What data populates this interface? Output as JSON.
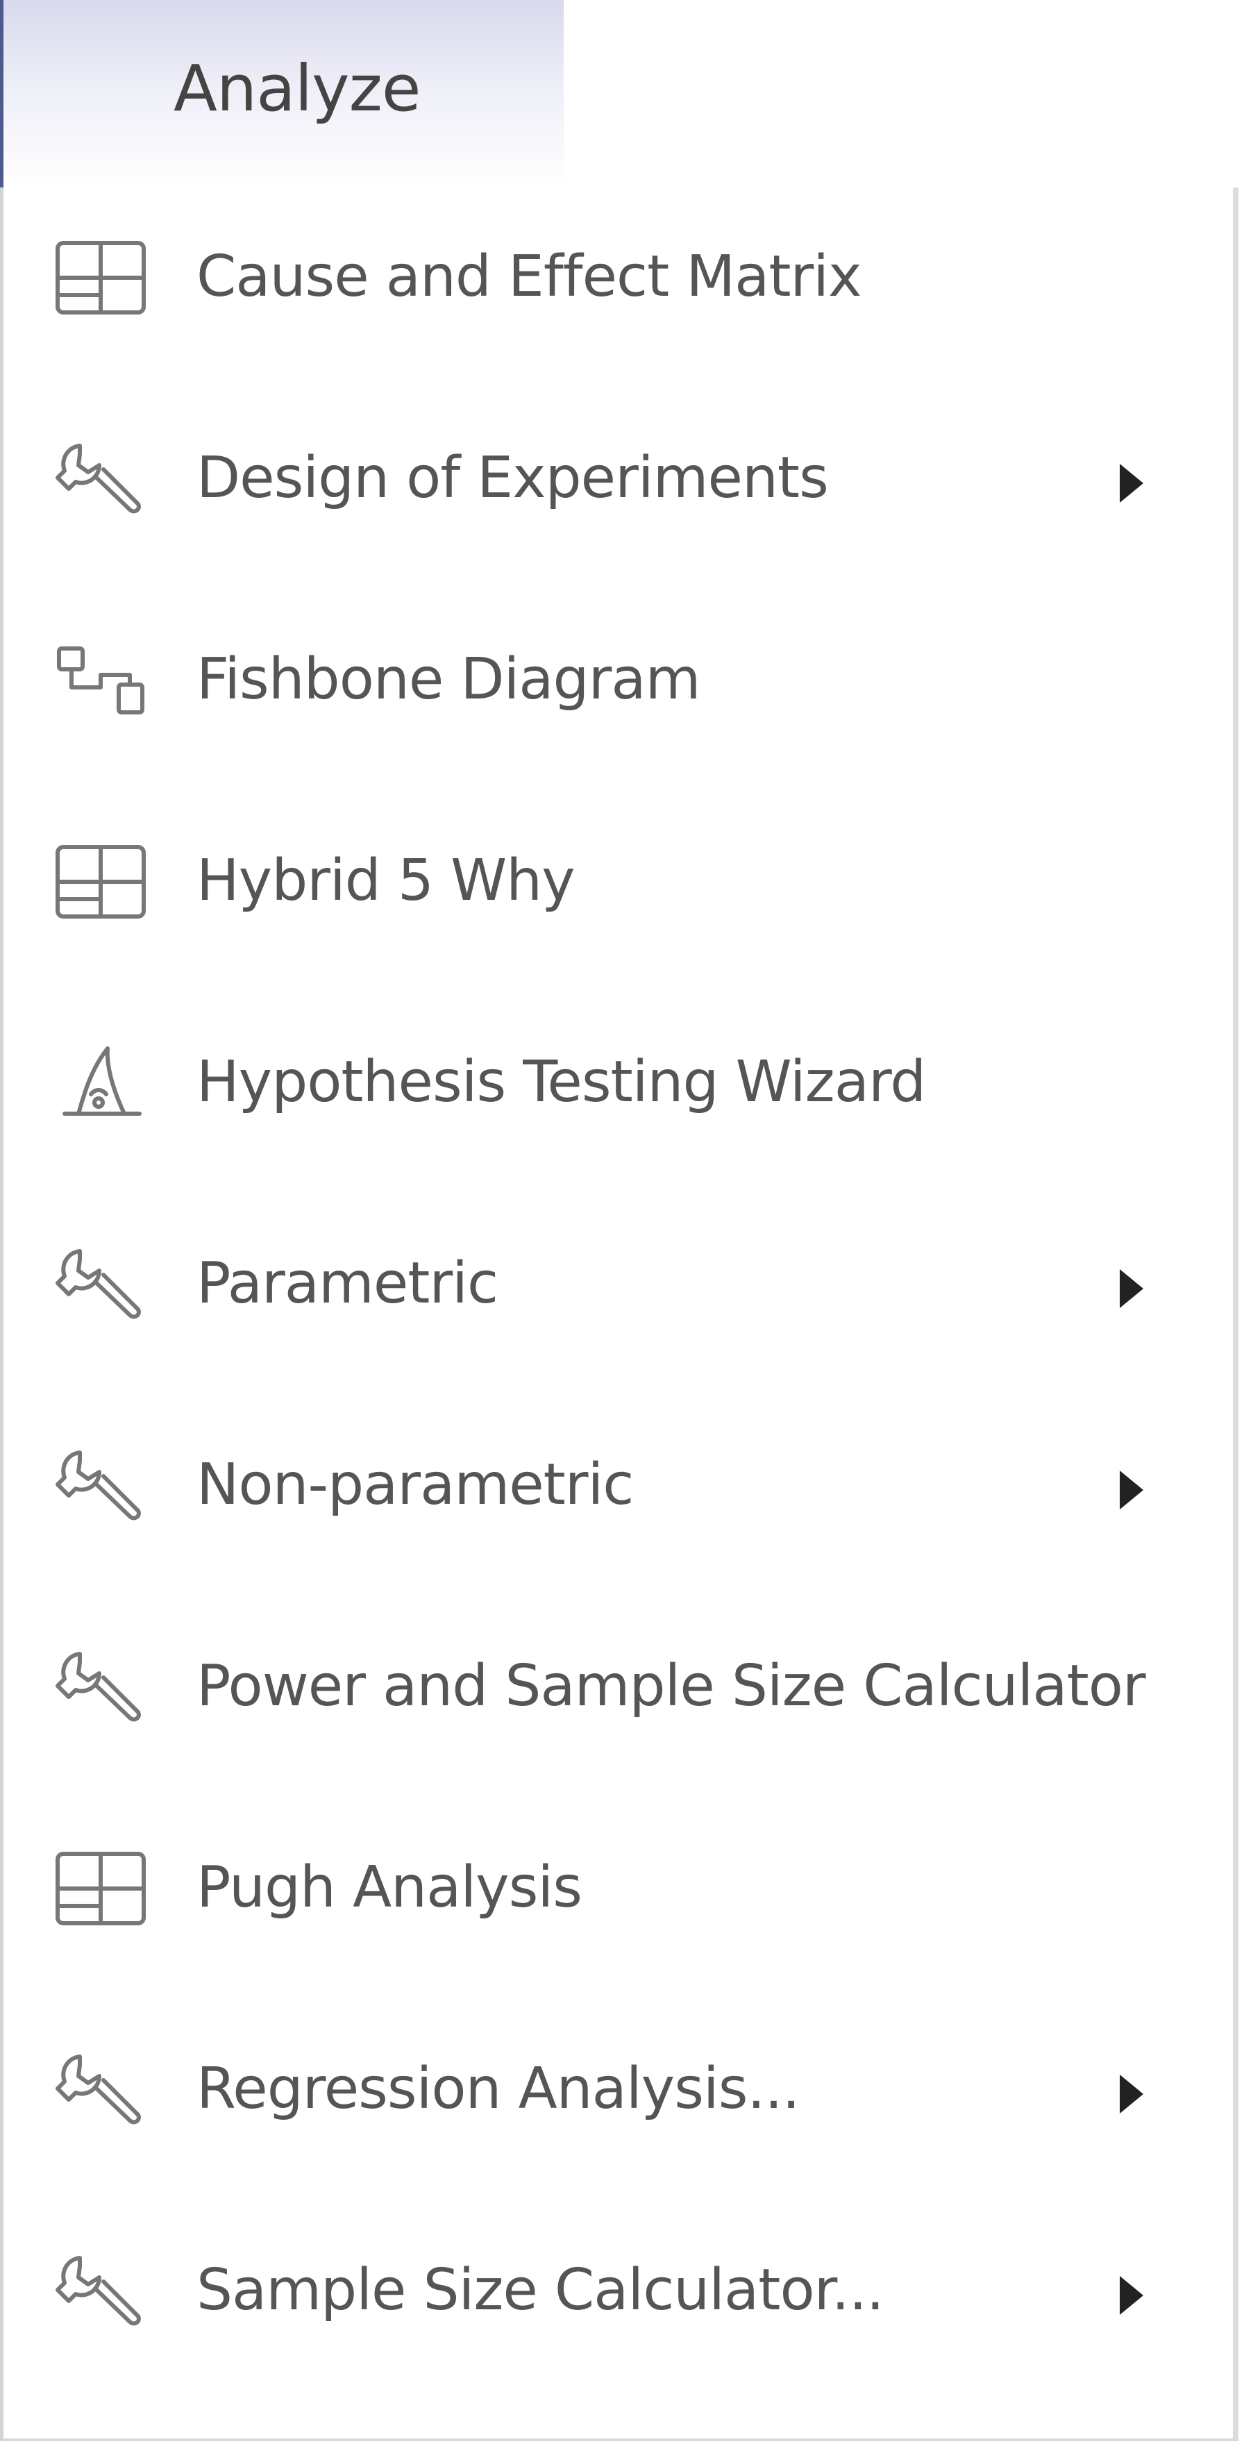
{
  "tab": {
    "label": "Analyze"
  },
  "menu": {
    "items": [
      {
        "label": "Cause and Effect Matrix",
        "icon": "table-icon",
        "has_submenu": false
      },
      {
        "label": "Design of Experiments",
        "icon": "wrench-icon",
        "has_submenu": true
      },
      {
        "label": "Fishbone Diagram",
        "icon": "diagram-icon",
        "has_submenu": false
      },
      {
        "label": "Hybrid 5 Why",
        "icon": "table-icon",
        "has_submenu": false
      },
      {
        "label": "Hypothesis Testing Wizard",
        "icon": "wizard-hat-icon",
        "has_submenu": false
      },
      {
        "label": "Parametric",
        "icon": "wrench-icon",
        "has_submenu": true
      },
      {
        "label": "Non-parametric",
        "icon": "wrench-icon",
        "has_submenu": true
      },
      {
        "label": "Power and Sample Size Calculator",
        "icon": "wrench-icon",
        "has_submenu": false
      },
      {
        "label": "Pugh Analysis",
        "icon": "table-icon",
        "has_submenu": false
      },
      {
        "label": "Regression Analysis...",
        "icon": "wrench-icon",
        "has_submenu": true
      },
      {
        "label": "Sample Size Calculator...",
        "icon": "wrench-icon",
        "has_submenu": true
      }
    ]
  },
  "colors": {
    "text": "#555555",
    "icon": "#777777",
    "arrow": "#222222",
    "tab_gradient_top": "#d9d9ee"
  }
}
